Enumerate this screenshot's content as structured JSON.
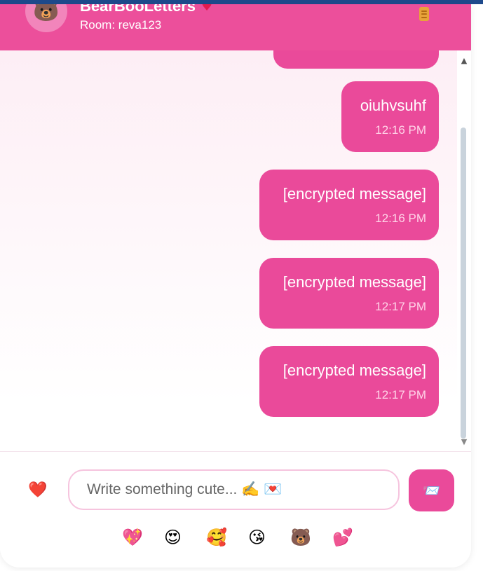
{
  "header": {
    "avatar_emoji": "🐻",
    "title": "BearBooLetters",
    "title_heart": "♥",
    "room": "Room: reva123",
    "menu_icon": "menu-icon"
  },
  "messages": [
    {
      "text": "oiuhvsuhf",
      "time": "12:16 PM"
    },
    {
      "text": "[encrypted message]",
      "time": "12:16 PM"
    },
    {
      "text": "[encrypted message]",
      "time": "12:17 PM"
    },
    {
      "text": "[encrypted message]",
      "time": "12:17 PM"
    }
  ],
  "composer": {
    "heart_emoji": "❤️",
    "placeholder": "Write something cute... ✍️ 💌",
    "send_emoji": "📨"
  },
  "emoji_bar": [
    "💖",
    "😍",
    "🥰",
    "😘",
    "🐻",
    "💕"
  ],
  "colors": {
    "accent": "#ea4a9a",
    "header": "#ec4f9b",
    "input_border": "#f6c4de",
    "top_strip": "#1e4a8c"
  }
}
